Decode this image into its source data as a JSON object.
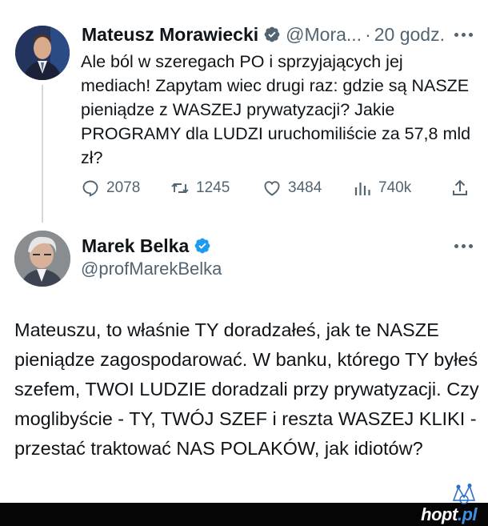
{
  "colors": {
    "text_primary": "#0f1419",
    "text_secondary": "#536471",
    "verified_blue": "#1d9bf0",
    "thread_line": "#cfd9de",
    "footer_bar": "#050505"
  },
  "tweet1": {
    "author_name": "Mateusz Morawiecki",
    "handle": "@Mora...",
    "separator": "·",
    "time": "20 godz.",
    "text": "Ale ból w szeregach PO i sprzyjających jej mediach! Zapytam wiec drugi raz: gdzie są NASZE pieniądze z WASZEJ prywatyzacji? Jakie PROGRAMY dla LUDZI uruchomiliście za 57,8 mld zł?",
    "replies": "2078",
    "retweets": "1245",
    "likes": "3484",
    "views": "740k",
    "icons": [
      "verified-badge",
      "more-icon",
      "reply-icon",
      "retweet-icon",
      "like-icon",
      "views-icon",
      "share-icon"
    ]
  },
  "tweet2": {
    "author_name": "Marek Belka",
    "handle": "@profMarekBelka",
    "text": "Mateuszu, to właśnie TY doradzałeś, jak te NASZE pieniądze zagospodarować. W banku, którego TY byłeś szefem, TWOI LUDZIE doradzali przy prywatyzacji. Czy moglibyście - TY, TWÓJ SZEF i reszta WASZEJ KLIKI - przestać traktować NAS POLAKÓW, jak idiotów?",
    "icons": [
      "verified-badge",
      "more-icon"
    ]
  },
  "watermark": {
    "main": "hopt",
    "suffix": ".pl"
  }
}
